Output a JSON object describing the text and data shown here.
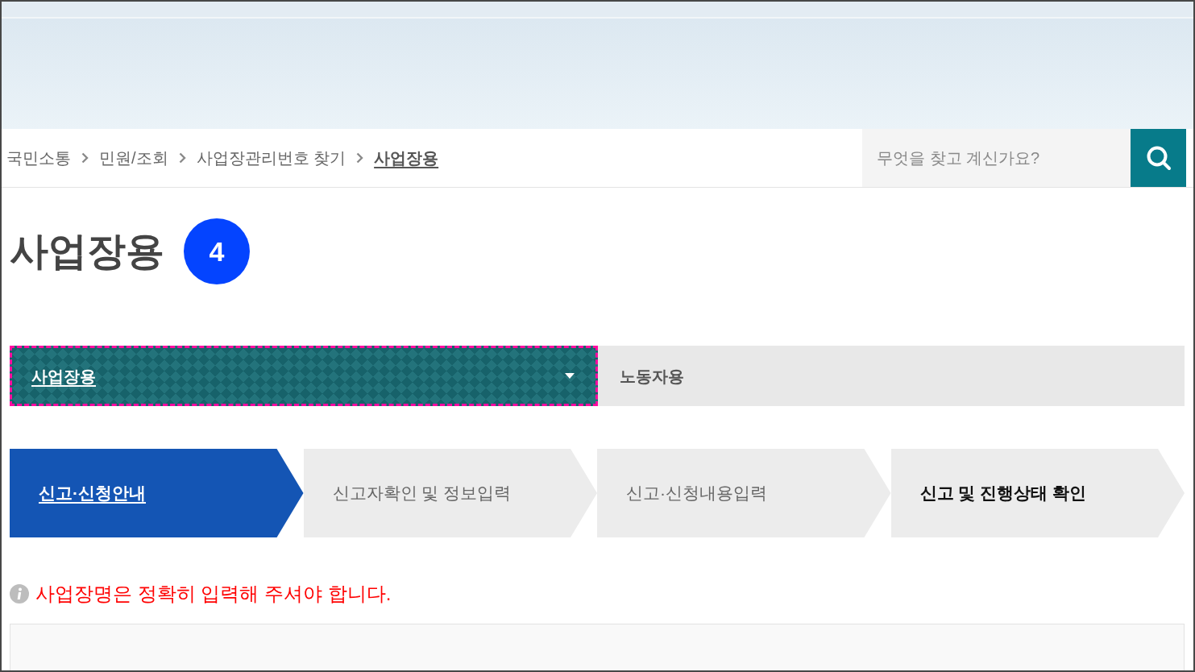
{
  "breadcrumb": [
    {
      "label": "국민소통",
      "current": false
    },
    {
      "label": "민원/조회",
      "current": false
    },
    {
      "label": "사업장관리번호 찾기",
      "current": false
    },
    {
      "label": "사업장용",
      "current": true
    }
  ],
  "search": {
    "placeholder": "무엇을 찾고 계신가요?"
  },
  "page_title": "사업장용",
  "marker": "4",
  "tabs": [
    {
      "label": "사업장용",
      "kind": "dropdown",
      "selected": true,
      "focused": true
    },
    {
      "label": "노동자용",
      "kind": "tab",
      "selected": false,
      "focused": false
    }
  ],
  "steps": [
    {
      "label": "신고·신청안내",
      "selected": true,
      "highlighted": false
    },
    {
      "label": "신고자확인 및 정보입력",
      "selected": false,
      "highlighted": false
    },
    {
      "label": "신고·신청내용입력",
      "selected": false,
      "highlighted": false
    },
    {
      "label": "신고 및 진행상태 확인",
      "selected": false,
      "highlighted": true
    }
  ],
  "notice": "사업장명은 정확히 입력해 주셔야 합니다."
}
